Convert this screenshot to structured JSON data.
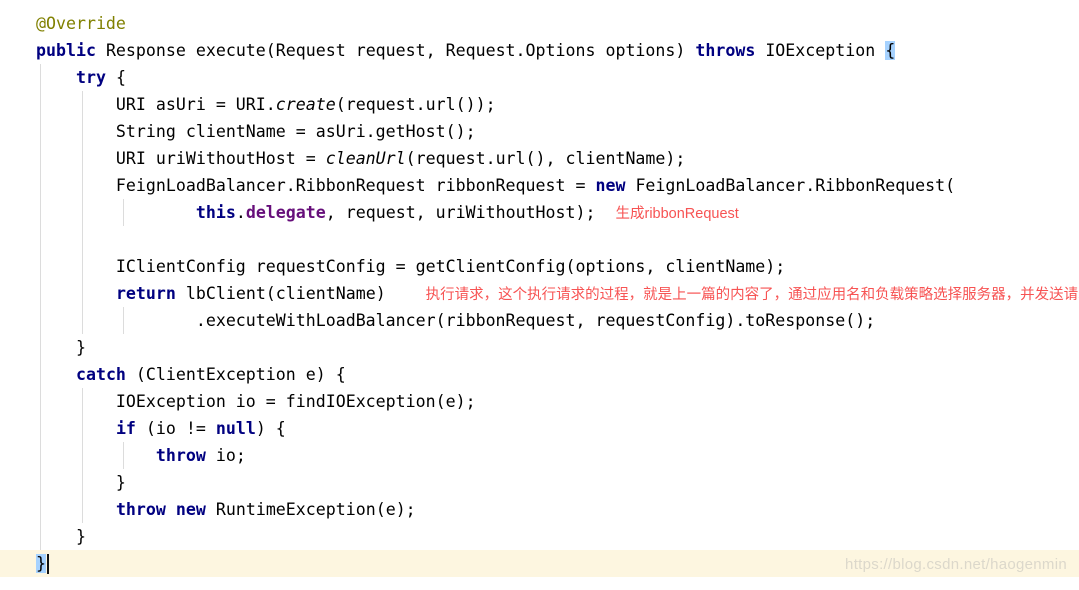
{
  "editor": {
    "watermark": "https://blog.csdn.net/haogenmin",
    "colors": {
      "keyword": "#000080",
      "annotation": "#808000",
      "field": "#660E7A",
      "plain": "#000000",
      "note_red": "#F75353",
      "brace_match_bg": "#A6D2FF",
      "current_line_bg": "#FDF6E0",
      "indent_guide": "#DCDCDC",
      "watermark": "#DCD8CB",
      "background": "#FFFFFF"
    },
    "code_lines": [
      {
        "segments": [
          {
            "t": "@Override",
            "c": "a"
          }
        ]
      },
      {
        "segments": [
          {
            "t": "public",
            "c": "k"
          },
          {
            "t": " Response execute(Request request, Request.Options options) ",
            "c": "p"
          },
          {
            "t": "throws",
            "c": "k"
          },
          {
            "t": " IOException ",
            "c": "p"
          },
          {
            "t": "{",
            "c": "b"
          }
        ]
      },
      {
        "segments": [
          {
            "t": "    ",
            "c": "p"
          },
          {
            "t": "try",
            "c": "k"
          },
          {
            "t": " {",
            "c": "p"
          }
        ]
      },
      {
        "segments": [
          {
            "t": "        URI asUri = URI.",
            "c": "p"
          },
          {
            "t": "create",
            "c": "i"
          },
          {
            "t": "(request.url());",
            "c": "p"
          }
        ]
      },
      {
        "segments": [
          {
            "t": "        String clientName = asUri.getHost();",
            "c": "p"
          }
        ]
      },
      {
        "segments": [
          {
            "t": "        URI uriWithoutHost = ",
            "c": "p"
          },
          {
            "t": "cleanUrl",
            "c": "i"
          },
          {
            "t": "(request.url(), clientName);",
            "c": "p"
          }
        ]
      },
      {
        "segments": [
          {
            "t": "        FeignLoadBalancer.RibbonRequest ribbonRequest = ",
            "c": "p"
          },
          {
            "t": "new",
            "c": "k"
          },
          {
            "t": " FeignLoadBalancer.RibbonRequest(",
            "c": "p"
          }
        ]
      },
      {
        "segments": [
          {
            "t": "                ",
            "c": "p"
          },
          {
            "t": "this",
            "c": "k"
          },
          {
            "t": ".",
            "c": "p"
          },
          {
            "t": "delegate",
            "c": "f"
          },
          {
            "t": ", request, uriWithoutHost);  ",
            "c": "p"
          },
          {
            "t": "生成ribbonRequest",
            "c": "r"
          }
        ]
      },
      {
        "segments": []
      },
      {
        "segments": [
          {
            "t": "        IClientConfig requestConfig = getClientConfig(options, clientName);",
            "c": "p"
          }
        ]
      },
      {
        "segments": [
          {
            "t": "        ",
            "c": "p"
          },
          {
            "t": "return",
            "c": "k"
          },
          {
            "t": " lbClient(clientName)    ",
            "c": "p"
          },
          {
            "t": "执行请求，这个执行请求的过程，就是上一篇的内容了，通过应用名和负载策略选择服务器，并发送请求",
            "c": "r"
          }
        ]
      },
      {
        "segments": [
          {
            "t": "                .executeWithLoadBalancer(ribbonRequest, requestConfig).toResponse();",
            "c": "p"
          }
        ]
      },
      {
        "segments": [
          {
            "t": "    }",
            "c": "p"
          }
        ]
      },
      {
        "segments": [
          {
            "t": "    ",
            "c": "p"
          },
          {
            "t": "catch",
            "c": "k"
          },
          {
            "t": " (ClientException e) {",
            "c": "p"
          }
        ]
      },
      {
        "segments": [
          {
            "t": "        IOException io = findIOException(e);",
            "c": "p"
          }
        ]
      },
      {
        "segments": [
          {
            "t": "        ",
            "c": "p"
          },
          {
            "t": "if",
            "c": "k"
          },
          {
            "t": " (io != ",
            "c": "p"
          },
          {
            "t": "null",
            "c": "k"
          },
          {
            "t": ") {",
            "c": "p"
          }
        ]
      },
      {
        "segments": [
          {
            "t": "            ",
            "c": "p"
          },
          {
            "t": "throw",
            "c": "k"
          },
          {
            "t": " io;",
            "c": "p"
          }
        ]
      },
      {
        "segments": [
          {
            "t": "        }",
            "c": "p"
          }
        ]
      },
      {
        "segments": [
          {
            "t": "        ",
            "c": "p"
          },
          {
            "t": "throw",
            "c": "k"
          },
          {
            "t": " ",
            "c": "p"
          },
          {
            "t": "new",
            "c": "k"
          },
          {
            "t": " RuntimeException(e);",
            "c": "p"
          }
        ]
      },
      {
        "segments": [
          {
            "t": "    }",
            "c": "p"
          }
        ]
      },
      {
        "segments": [
          {
            "t": "}",
            "c": "b"
          }
        ],
        "current": true,
        "caret": true
      }
    ]
  }
}
